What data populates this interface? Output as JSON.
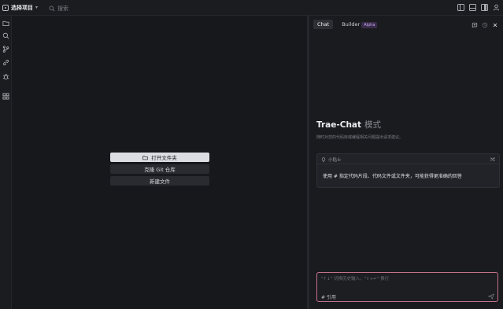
{
  "topbar": {
    "project_label": "选择项目",
    "search_label": "搜索"
  },
  "welcome": {
    "open_folder": "打开文件夹",
    "clone_git": "克隆 Git 仓库",
    "new_file": "新建文件"
  },
  "panel": {
    "tabs": [
      {
        "label": "Chat",
        "active": true
      },
      {
        "label": "Builder",
        "badge": "Alpha"
      }
    ],
    "title": "Trae-Chat",
    "mode": "模式",
    "subtitle": "随时对您的代码库或编程相关问题提出请求建议。",
    "tip_label": "小贴士",
    "tip_text": "使用 # 指定代码片段、代码文件或文件夹，可能获得更准确的回答",
    "input_placeholder": "\"↑↓\" 切换历史输入，\"⇧+↵\" 换行",
    "reference_label": "# 引用"
  },
  "colors": {
    "accent_border": "#c5728a",
    "badge_text": "#c6a8ee",
    "primary_button": "#dcdde2"
  },
  "icons": [
    "folder-icon",
    "search-icon",
    "branch-icon",
    "link-icon",
    "bug-icon",
    "extensions-icon",
    "bulb-icon",
    "shuffle-icon",
    "send-icon",
    "history-icon",
    "new-chat-icon",
    "close-icon"
  ]
}
